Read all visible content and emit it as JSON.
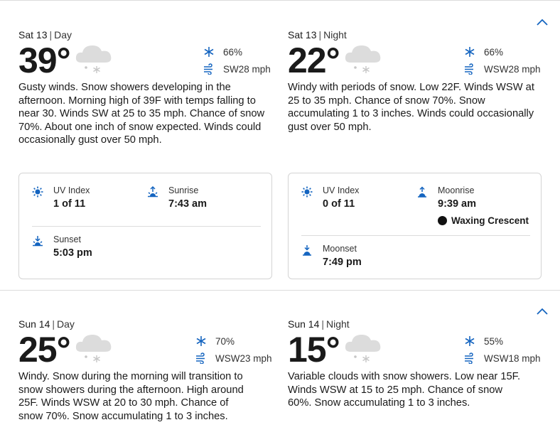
{
  "sections": [
    {
      "day": {
        "date": "Sat 13",
        "time": "Day",
        "temp": "39°",
        "precip": "66%",
        "wind": "SW28 mph",
        "description": "Gusty winds. Snow showers developing in the afternoon. Morning high of 39F with temps falling to near 30. Winds SW at 25 to 35 mph. Chance of snow 70%. About one inch of snow expected. Winds could occasionally gust over 50 mph.",
        "uv_label": "UV Index",
        "uv_value": "1 of 11",
        "sunrise_label": "Sunrise",
        "sunrise_value": "7:43 am",
        "sunset_label": "Sunset",
        "sunset_value": "5:03 pm"
      },
      "night": {
        "date": "Sat 13",
        "time": "Night",
        "temp": "22°",
        "precip": "66%",
        "wind": "WSW28 mph",
        "description": "Windy with periods of snow. Low 22F. Winds WSW at 25 to 35 mph. Chance of snow 70%. Snow accumulating 1 to 3 inches. Winds could occasionally gust over 50 mph.",
        "uv_label": "UV Index",
        "uv_value": "0 of 11",
        "moonrise_label": "Moonrise",
        "moonrise_value": "9:39 am",
        "moon_phase": "Waxing Crescent",
        "moonset_label": "Moonset",
        "moonset_value": "7:49 pm"
      }
    },
    {
      "day": {
        "date": "Sun 14",
        "time": "Day",
        "temp": "25°",
        "precip": "70%",
        "wind": "WSW23 mph",
        "description": "Windy. Snow during the morning will transition to snow showers during the afternoon. High around 25F. Winds WSW at 20 to 30 mph. Chance of snow 70%. Snow accumulating 1 to 3 inches."
      },
      "night": {
        "date": "Sun 14",
        "time": "Night",
        "temp": "15°",
        "precip": "55%",
        "wind": "WSW18 mph",
        "description": "Variable clouds with snow showers. Low near 15F. Winds WSW at 15 to 25 mph. Chance of snow 60%. Snow accumulating 1 to 3 inches."
      }
    }
  ],
  "colors": {
    "accent": "#1565c0",
    "text": "#1a1a1a",
    "border": "#d4d4d4"
  }
}
